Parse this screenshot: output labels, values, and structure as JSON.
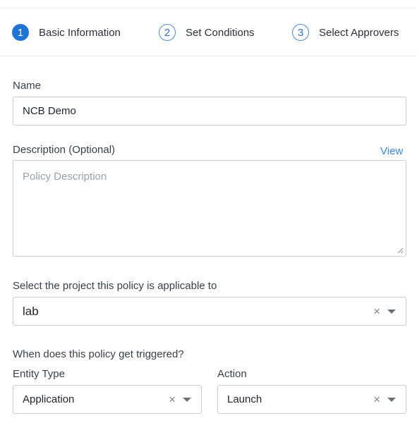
{
  "stepper": {
    "steps": [
      {
        "number": "1",
        "label": "Basic Information",
        "active": true
      },
      {
        "number": "2",
        "label": "Set Conditions",
        "active": false
      },
      {
        "number": "3",
        "label": "Select Approvers",
        "active": false
      }
    ]
  },
  "form": {
    "name": {
      "label": "Name",
      "value": "NCB Demo"
    },
    "description": {
      "label": "Description (Optional)",
      "view_link": "View",
      "placeholder": "Policy Description",
      "value": ""
    },
    "project": {
      "label": "Select the project this policy is applicable to",
      "value": "lab"
    },
    "trigger_heading": "When does this policy get triggered?",
    "entity_type": {
      "label": "Entity Type",
      "value": "Application"
    },
    "action": {
      "label": "Action",
      "value": "Launch"
    }
  },
  "icons": {
    "clear": "clear-x-icon",
    "dropdown": "chevron-down-icon",
    "resize": "resize-handle-icon"
  },
  "colors": {
    "accent": "#1f74d8",
    "link": "#3b88e0",
    "border": "#c9ccd1",
    "placeholder": "#9aa0a8"
  }
}
